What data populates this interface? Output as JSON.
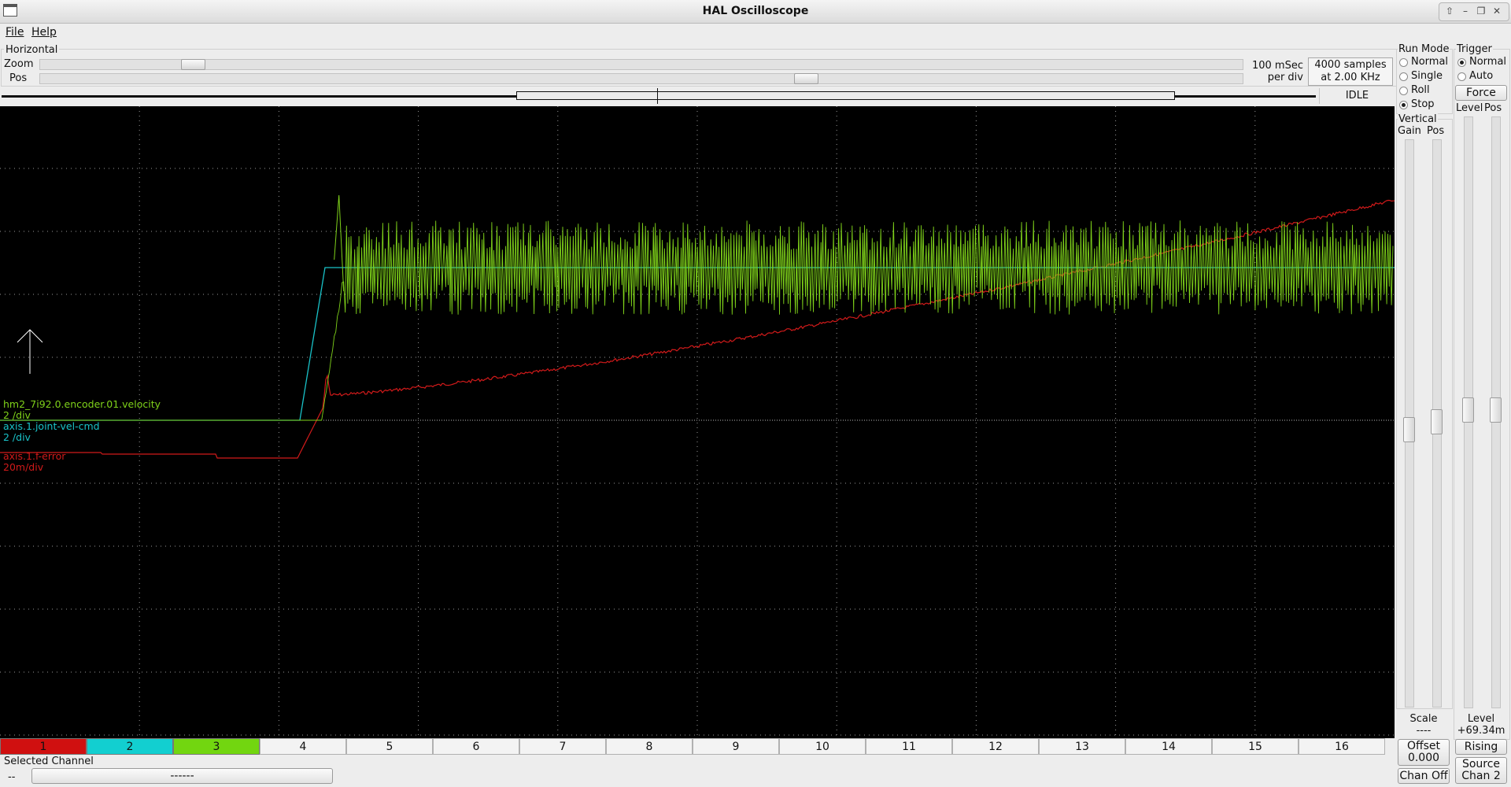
{
  "window": {
    "title": "HAL Oscilloscope"
  },
  "menu": {
    "file": "File",
    "help": "Help"
  },
  "horizontal": {
    "label": "Horizontal",
    "zoom_label": "Zoom",
    "pos_label": "Pos",
    "zoom_value": 0.12,
    "pos_value": 0.64,
    "time_per_div_line1": "100 mSec",
    "time_per_div_line2": "per div",
    "samples_line1": "4000 samples",
    "samples_line2": "at 2.00 KHz",
    "state": "IDLE"
  },
  "run_mode": {
    "label": "Run Mode",
    "options": [
      "Normal",
      "Single",
      "Roll",
      "Stop"
    ],
    "selected": "Stop"
  },
  "trigger": {
    "label": "Trigger",
    "options": [
      "Normal",
      "Auto"
    ],
    "selected": "Normal",
    "force_label": "Force",
    "level_label": "Level",
    "pos_label": "Pos",
    "level_text": "Level",
    "level_value": "+69.34m",
    "edge_label": "Rising",
    "source_line1": "Source",
    "source_line2": "Chan  2"
  },
  "vertical": {
    "label": "Vertical",
    "gain_label": "Gain",
    "pos_label": "Pos",
    "scale_label": "Scale",
    "scale_value": "----",
    "offset_label": "Offset",
    "offset_value": "0.000",
    "chan_off_label": "Chan Off"
  },
  "channels": {
    "buttons": [
      "1",
      "2",
      "3",
      "4",
      "5",
      "6",
      "7",
      "8",
      "9",
      "10",
      "11",
      "12",
      "13",
      "14",
      "15",
      "16"
    ],
    "colors": {
      "1": "#d01010",
      "2": "#12cfd0",
      "3": "#72d610"
    }
  },
  "selected_channel": {
    "label": "Selected Channel",
    "number": "--",
    "name": "------"
  },
  "scope": {
    "traces": [
      {
        "name": "hm2_7i92.0.encoder.01.velocity",
        "scale": "2 /div",
        "color": "#7fd21a"
      },
      {
        "name": "axis.1.joint-vel-cmd",
        "scale": "2 /div",
        "color": "#19c2c8"
      },
      {
        "name": "axis.1.f-error",
        "scale": "20m/div",
        "color": "#d11a1a"
      }
    ]
  },
  "chart_data": {
    "type": "line",
    "x_divisions": 10,
    "y_divisions": 10,
    "grid": true,
    "series": [
      {
        "name": "hm2_7i92.0.encoder.01.velocity",
        "scale": "2 /div",
        "color": "#7fd21a",
        "baseline_div": 0,
        "settled_div": 3.3,
        "noise_div": 0.9,
        "step_at_div": 2.25
      },
      {
        "name": "axis.1.joint-vel-cmd",
        "scale": "2 /div",
        "color": "#19c2c8",
        "baseline_div": 0,
        "settled_div": 3.3,
        "step_at_div": 2.15
      },
      {
        "name": "axis.1.f-error",
        "scale": "20m/div",
        "color": "#d11a1a",
        "start_div": -0.6,
        "peak_div": 0.75,
        "end_div": 3.6
      }
    ]
  }
}
